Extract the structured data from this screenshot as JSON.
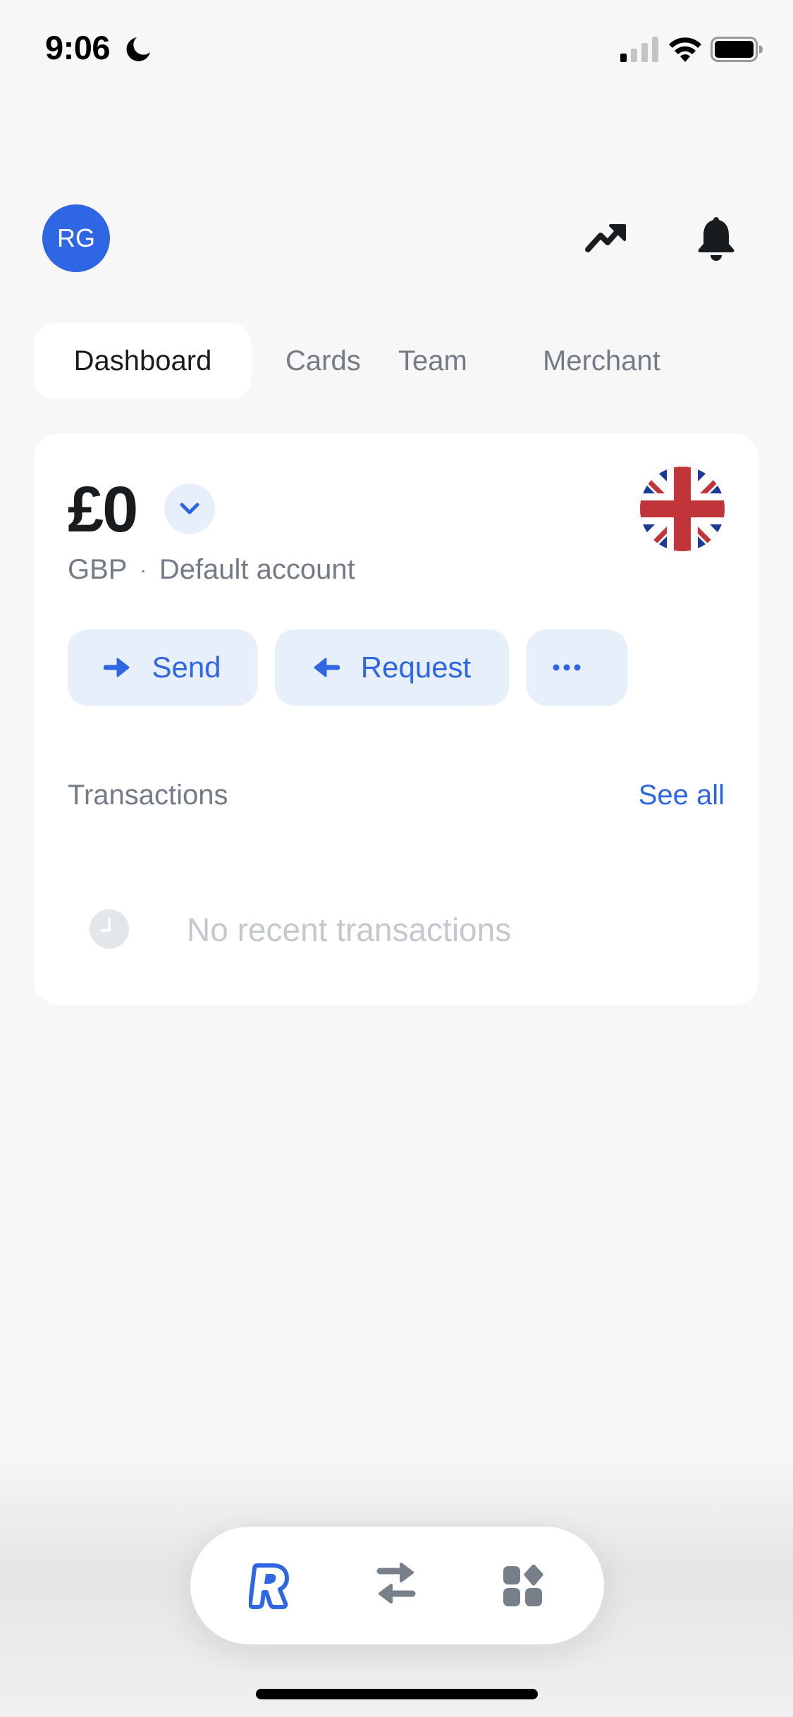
{
  "status_bar": {
    "time": "9:06",
    "focus_icon": "moon-icon",
    "signal_icon": "cellular-signal-icon",
    "wifi_icon": "wifi-icon",
    "battery_icon": "battery-icon"
  },
  "header": {
    "avatar_initials": "RG",
    "actions": [
      {
        "icon": "trending-up-icon"
      },
      {
        "icon": "bell-icon"
      }
    ]
  },
  "tabs": [
    {
      "label": "Dashboard",
      "active": true
    },
    {
      "label": "Cards",
      "active": false
    },
    {
      "label": "Team",
      "active": false
    },
    {
      "label": "Merchant",
      "active": false
    }
  ],
  "account": {
    "balance": "£0",
    "currency": "GBP",
    "separator": "·",
    "account_name": "Default account",
    "flag": "uk-flag-icon"
  },
  "actions": {
    "send_label": "Send",
    "request_label": "Request",
    "more_label": "···"
  },
  "transactions": {
    "title": "Transactions",
    "see_all_label": "See all",
    "empty_message": "No recent transactions"
  },
  "bottom_nav": {
    "items": [
      {
        "icon": "revolut-logo-icon",
        "active": true
      },
      {
        "icon": "transfer-arrows-icon",
        "active": false
      },
      {
        "icon": "hub-grid-icon",
        "active": false
      }
    ]
  },
  "colors": {
    "accent": "#2f66e4",
    "accent_soft": "#e7effb",
    "background": "#f7f7f7",
    "text_primary": "#191c1f",
    "text_secondary": "#727b86",
    "text_muted": "#c3c8cf",
    "icon_gray": "#77808a"
  }
}
